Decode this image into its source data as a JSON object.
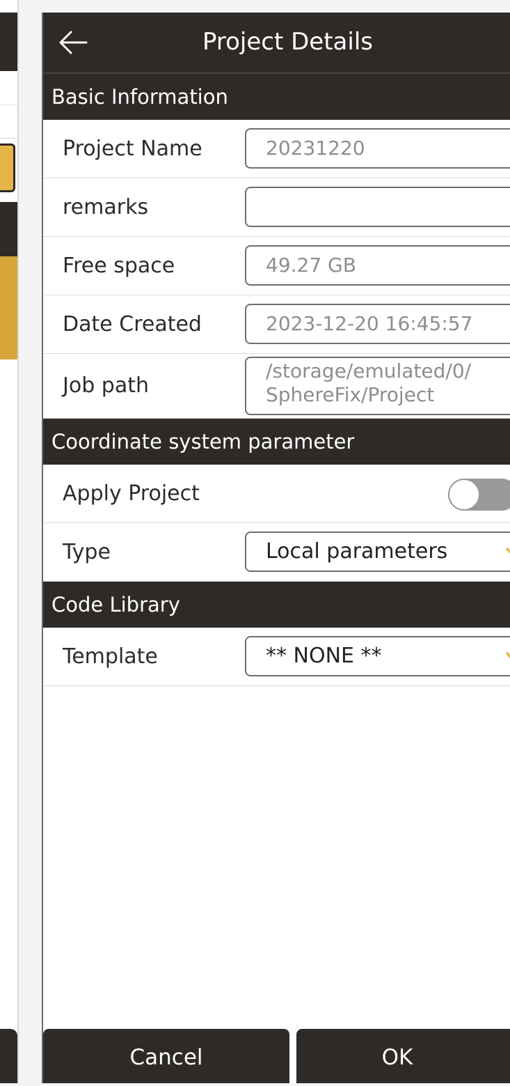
{
  "header": {
    "title": "Project Details"
  },
  "sections": {
    "basic": "Basic Information",
    "coord": "Coordinate system parameter",
    "code": "Code Library"
  },
  "basic": {
    "project_name_label": "Project Name",
    "project_name_value": "20231220",
    "remarks_label": "remarks",
    "remarks_value": "",
    "free_space_label": "Free space",
    "free_space_value": "49.27 GB",
    "date_created_label": "Date Created",
    "date_created_value": "2023-12-20 16:45:57",
    "job_path_label": "Job path",
    "job_path_line1": "/storage/emulated/0/",
    "job_path_line2": "SphereFix/Project"
  },
  "coord": {
    "apply_label": "Apply Project",
    "apply_on": false,
    "type_label": "Type",
    "type_value": "Local parameters"
  },
  "code": {
    "template_label": "Template",
    "template_value": "** NONE **"
  },
  "buttons": {
    "cancel": "Cancel",
    "ok": "OK"
  },
  "colors": {
    "dark": "#2e2a27",
    "accent": "#e6b548",
    "toggle_off": "#9a9a9a"
  },
  "icons": {
    "back": "arrow-left-icon",
    "dropdown": "chevron-down-icon"
  }
}
